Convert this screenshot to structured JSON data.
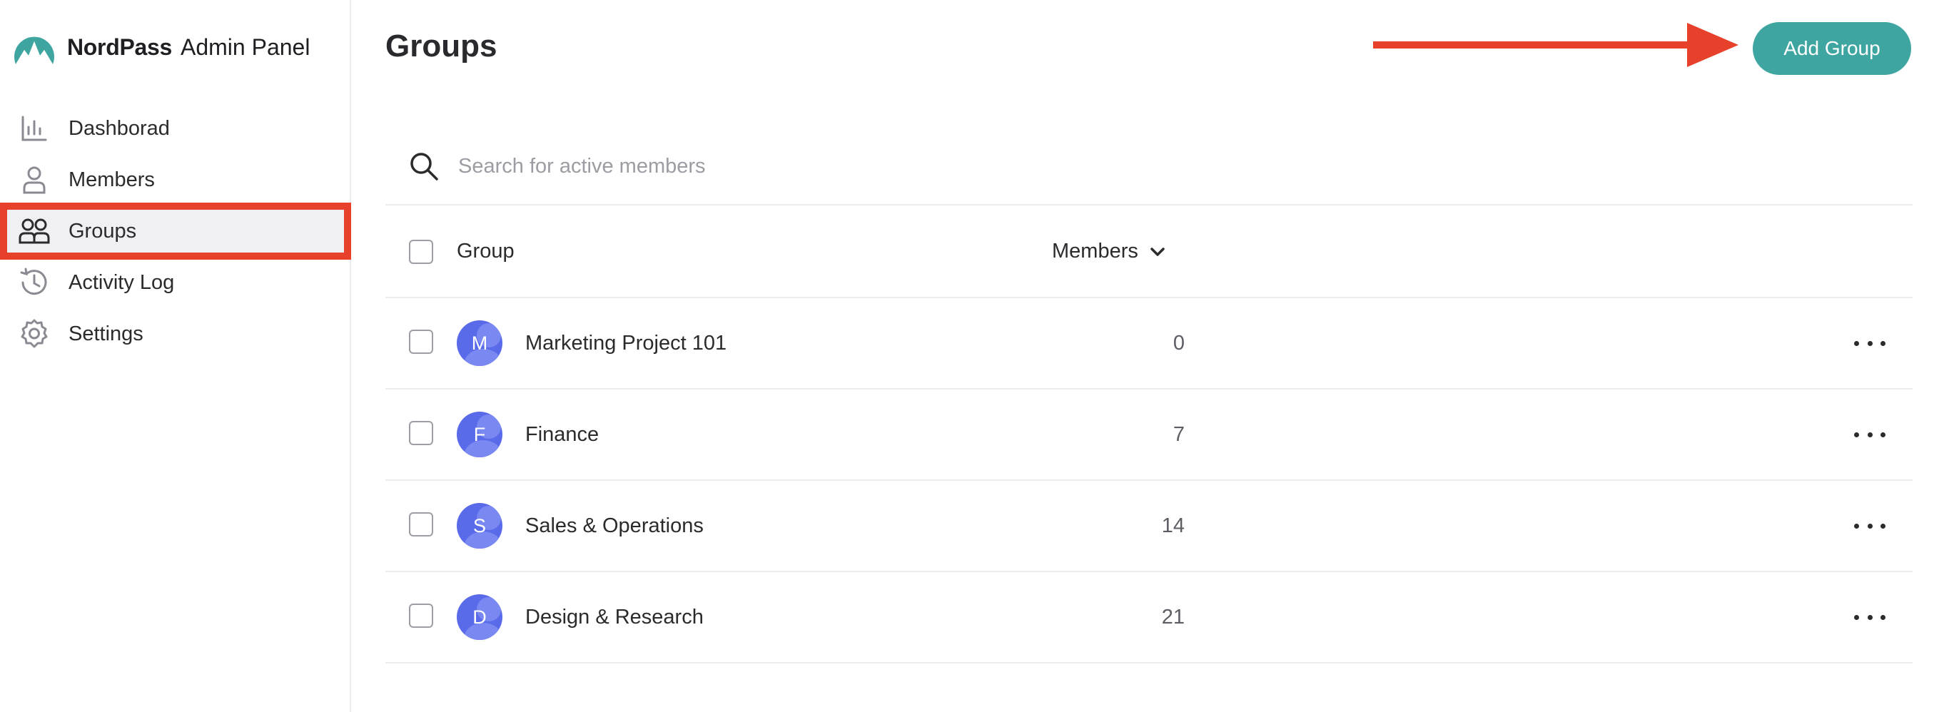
{
  "brand": {
    "name": "NordPass",
    "subtitle": "Admin Panel",
    "logo_color": "#3fa5a1"
  },
  "sidebar": {
    "items": [
      {
        "label": "Dashborad",
        "icon": "bar-chart-icon",
        "active": false
      },
      {
        "label": "Members",
        "icon": "user-icon",
        "active": false
      },
      {
        "label": "Groups",
        "icon": "users-icon",
        "active": true
      },
      {
        "label": "Activity Log",
        "icon": "history-icon",
        "active": false
      },
      {
        "label": "Settings",
        "icon": "gear-icon",
        "active": false
      }
    ]
  },
  "header": {
    "title": "Groups",
    "add_button_label": "Add Group",
    "accent_color": "#3fa5a1",
    "annotation_color": "#e8412b"
  },
  "search": {
    "placeholder": "Search for active members",
    "value": ""
  },
  "table": {
    "columns": {
      "group": "Group",
      "members": "Members"
    },
    "rows": [
      {
        "initial": "M",
        "name": "Marketing Project 101",
        "members": "0"
      },
      {
        "initial": "F",
        "name": "Finance",
        "members": "7"
      },
      {
        "initial": "S",
        "name": "Sales & Operations",
        "members": "14"
      },
      {
        "initial": "D",
        "name": "Design & Research",
        "members": "21"
      }
    ]
  }
}
